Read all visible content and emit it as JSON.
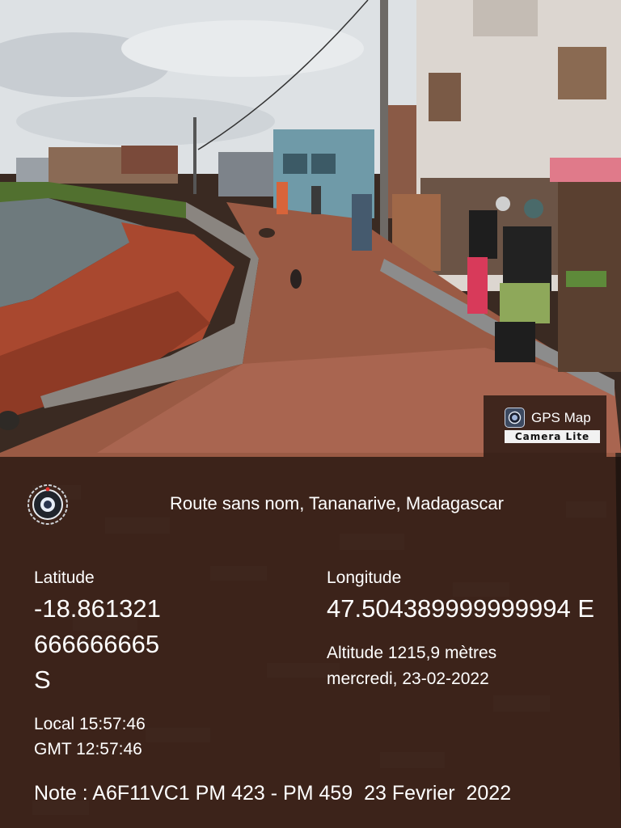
{
  "watermark": {
    "app_name": "GPS Map",
    "app_subtitle": "Camera Lite",
    "logo_icon": "camera-lens-icon"
  },
  "location": {
    "address": "Route sans nom, Tananarive, Madagascar",
    "latitude_label": "Latitude",
    "latitude_line1": "-18.861321",
    "latitude_line2": "666666665",
    "latitude_hemisphere": "S",
    "longitude_label": "Longitude",
    "longitude_value": "47.504389999999994 E",
    "altitude": "Altitude 1215,9 mètres",
    "date": "mercredi, 23-02-2022",
    "local_time": "Local 15:57:46",
    "gmt_time": "GMT 12:57:46",
    "note": "Note : A6F11VC1 PM 423 - PM 459  23 Fevrier  2022"
  },
  "colors": {
    "overlay": "#180e0a",
    "text": "#ffffff",
    "soil": "#a9482f",
    "sky": "#d9dde1"
  }
}
